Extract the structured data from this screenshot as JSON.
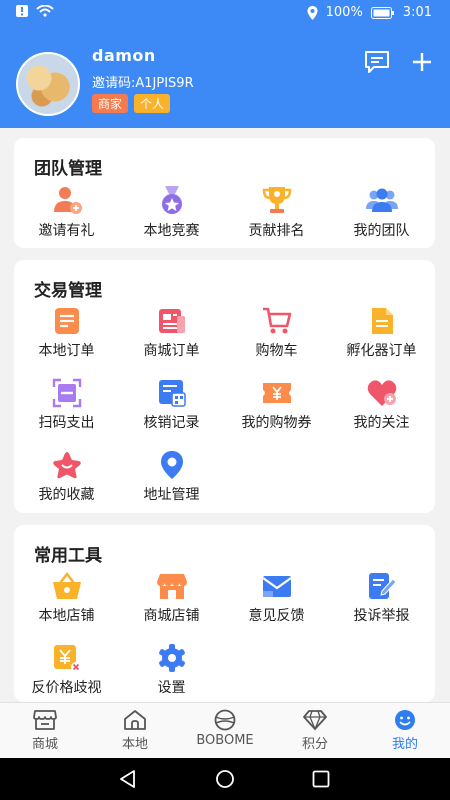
{
  "status_bar": {
    "battery": "100%",
    "time": "3:01"
  },
  "profile": {
    "username": "damon",
    "invite_code": "邀请码:A1JPIS9R",
    "tags": [
      "商家",
      "个人"
    ]
  },
  "sections": [
    {
      "title": "团队管理",
      "items": [
        {
          "label": "邀请有礼",
          "icon": "invite-icon"
        },
        {
          "label": "本地竞赛",
          "icon": "medal-icon"
        },
        {
          "label": "贡献排名",
          "icon": "trophy-icon"
        },
        {
          "label": "我的团队",
          "icon": "team-icon"
        }
      ]
    },
    {
      "title": "交易管理",
      "items": [
        {
          "label": "本地订单",
          "icon": "order-icon"
        },
        {
          "label": "商城订单",
          "icon": "mall-order-icon"
        },
        {
          "label": "购物车",
          "icon": "cart-icon"
        },
        {
          "label": "孵化器订单",
          "icon": "incubator-order-icon"
        },
        {
          "label": "扫码支出",
          "icon": "scan-icon"
        },
        {
          "label": "核销记录",
          "icon": "verify-record-icon"
        },
        {
          "label": "我的购物券",
          "icon": "coupon-icon"
        },
        {
          "label": "我的关注",
          "icon": "heart-icon"
        },
        {
          "label": "我的收藏",
          "icon": "star-icon"
        },
        {
          "label": "地址管理",
          "icon": "location-icon"
        }
      ]
    },
    {
      "title": "常用工具",
      "items": [
        {
          "label": "本地店铺",
          "icon": "basket-icon"
        },
        {
          "label": "商城店铺",
          "icon": "store-icon"
        },
        {
          "label": "意见反馈",
          "icon": "mail-icon"
        },
        {
          "label": "投诉举报",
          "icon": "edit-doc-icon"
        },
        {
          "label": "反价格歧视",
          "icon": "price-icon"
        },
        {
          "label": "设置",
          "icon": "gear-icon"
        }
      ]
    }
  ],
  "tabs": [
    {
      "label": "商城",
      "icon": "shop-icon"
    },
    {
      "label": "本地",
      "icon": "home-icon"
    },
    {
      "label": "BOBOME",
      "icon": "ball-icon"
    },
    {
      "label": "积分",
      "icon": "diamond-icon"
    },
    {
      "label": "我的",
      "icon": "smile-icon",
      "active": true
    }
  ],
  "colors": {
    "accent": "#3d8af7",
    "active_tab": "#2f7df2"
  }
}
